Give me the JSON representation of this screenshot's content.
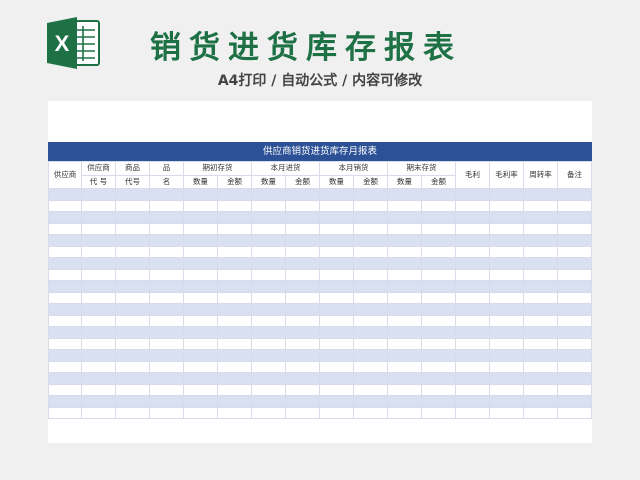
{
  "logo": {
    "icon": "excel-icon",
    "letter": "X",
    "color": "#1e7145"
  },
  "title": "销货进货库存报表",
  "subtitle": "A4打印 / 自动公式 / 内容可修改",
  "sheet": {
    "banner": "供应商销货进货库存月报表",
    "header_row1": [
      "供应商",
      "供应商",
      "商品",
      "品",
      "期初存货",
      "本月进货",
      "本月销货",
      "期末存货",
      "毛利",
      "毛利率",
      "周转率",
      "备注"
    ],
    "header_row2": [
      "代 号",
      "代号",
      "名",
      "数量",
      "金额",
      "数量",
      "金额",
      "数量",
      "金额",
      "数量",
      "金额"
    ],
    "colors": {
      "banner": "#2c5196",
      "stripe": "#d9e0f2",
      "title": "#1e7145"
    },
    "data_rows": 20
  }
}
